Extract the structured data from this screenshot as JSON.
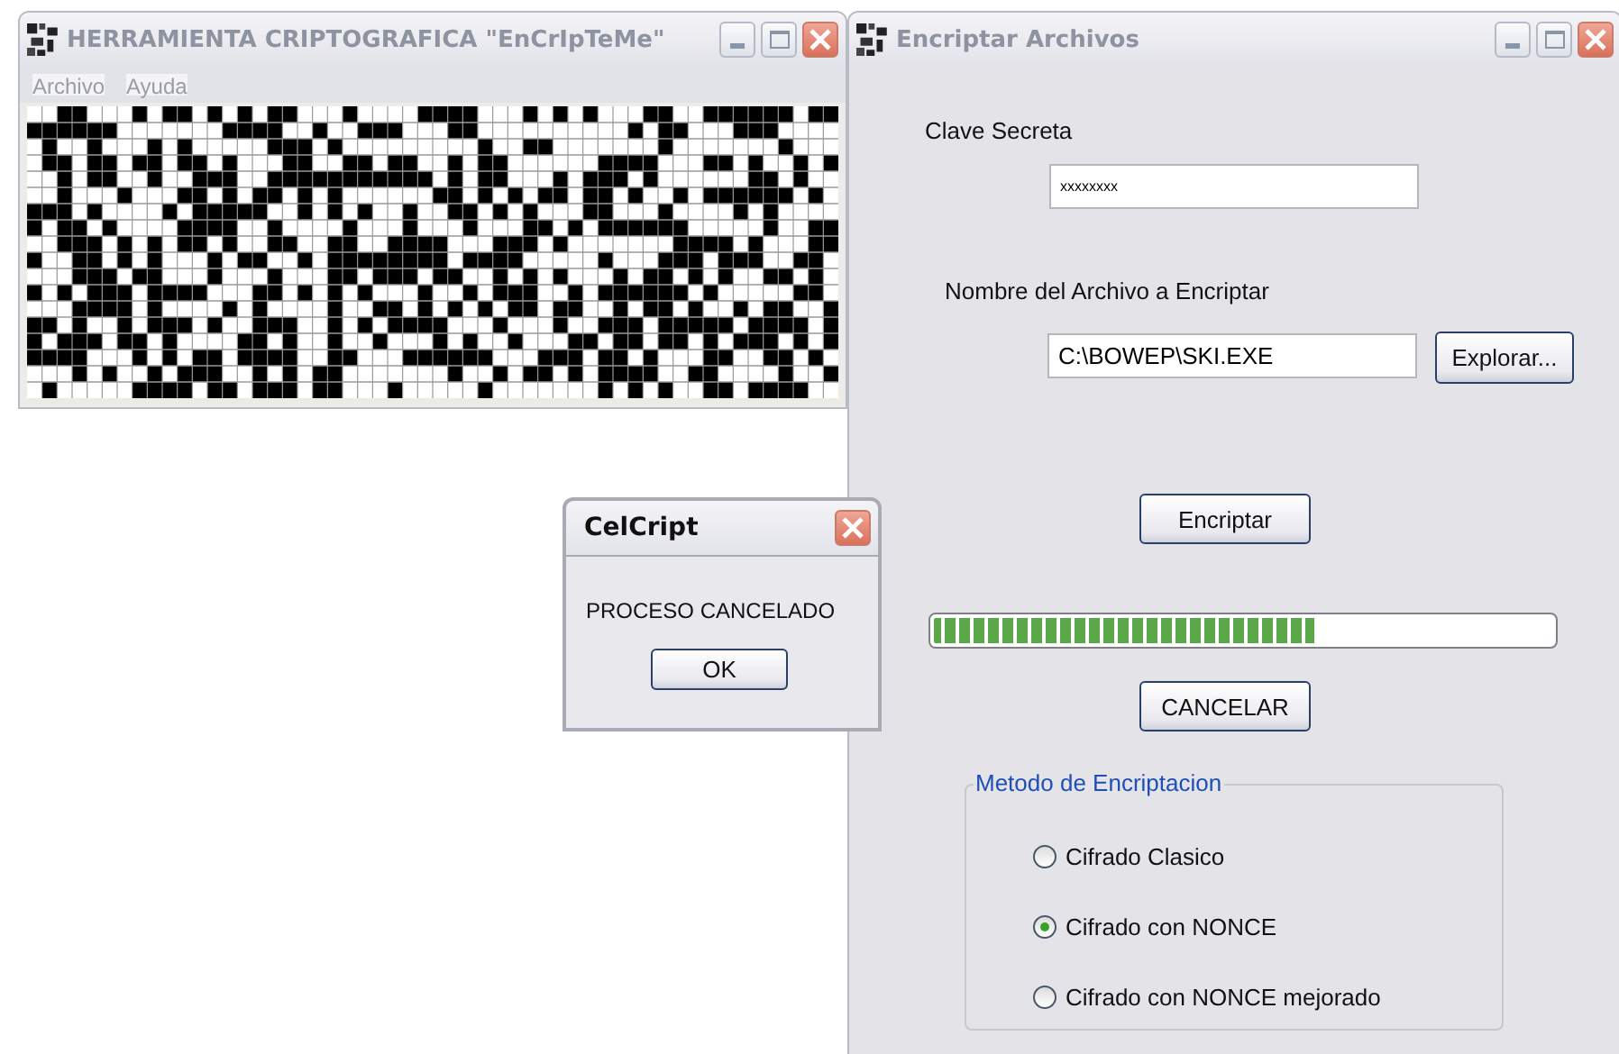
{
  "main_window": {
    "title": "HERRAMIENTA CRIPTOGRAFICA \"EnCrIpTeMe\"",
    "menu": [
      "Archivo",
      "Ayuda"
    ]
  },
  "encrypt_window": {
    "title": "Encriptar Archivos",
    "key_label": "Clave Secreta",
    "key_value": "xxxxxxxx",
    "file_label": "Nombre del Archivo a Encriptar",
    "file_value": "C:\\BOWEP\\SKI.EXE",
    "browse_button": "Explorar...",
    "encrypt_button": "Encriptar",
    "progress": {
      "level": 0.62
    },
    "cancel_button": "CANCELAR",
    "method_group": {
      "legend": "Metodo de Encriptacion",
      "options": [
        {
          "label": "Cifrado Clasico",
          "selected": false
        },
        {
          "label": "Cifrado con NONCE",
          "selected": true
        },
        {
          "label": "Cifrado con NONCE mejorado",
          "selected": false
        }
      ]
    }
  },
  "dialog": {
    "title": "CelCript",
    "message": "PROCESO CANCELADO",
    "ok_button": "OK"
  }
}
